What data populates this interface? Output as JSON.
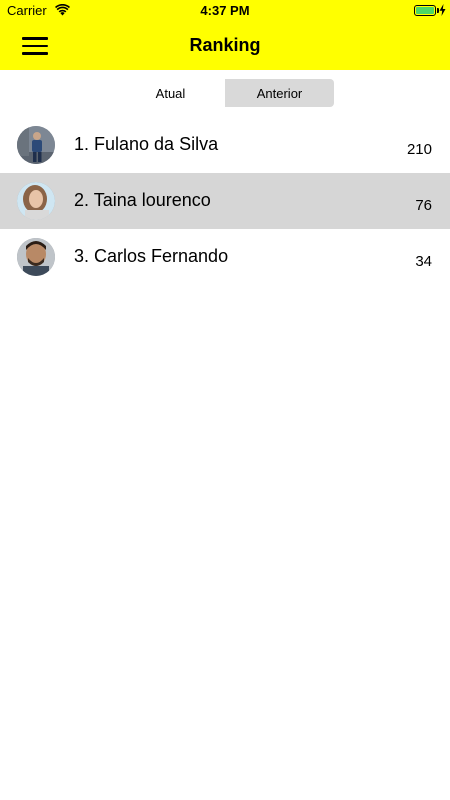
{
  "status_bar": {
    "carrier": "Carrier",
    "time": "4:37 PM",
    "battery_color": "#4cd964"
  },
  "header": {
    "title": "Ranking",
    "background": "#ffff00",
    "menu_icon": "hamburger-menu-icon"
  },
  "tabs": [
    {
      "label": "Atual",
      "active": true
    },
    {
      "label": "Anterior",
      "active": false
    }
  ],
  "ranking": [
    {
      "name": "1. Fulano da Silva",
      "score": "210",
      "selected": false
    },
    {
      "name": "2. Taina lourenco",
      "score": "76",
      "selected": true
    },
    {
      "name": "3. Carlos Fernando",
      "score": "34",
      "selected": false
    }
  ]
}
